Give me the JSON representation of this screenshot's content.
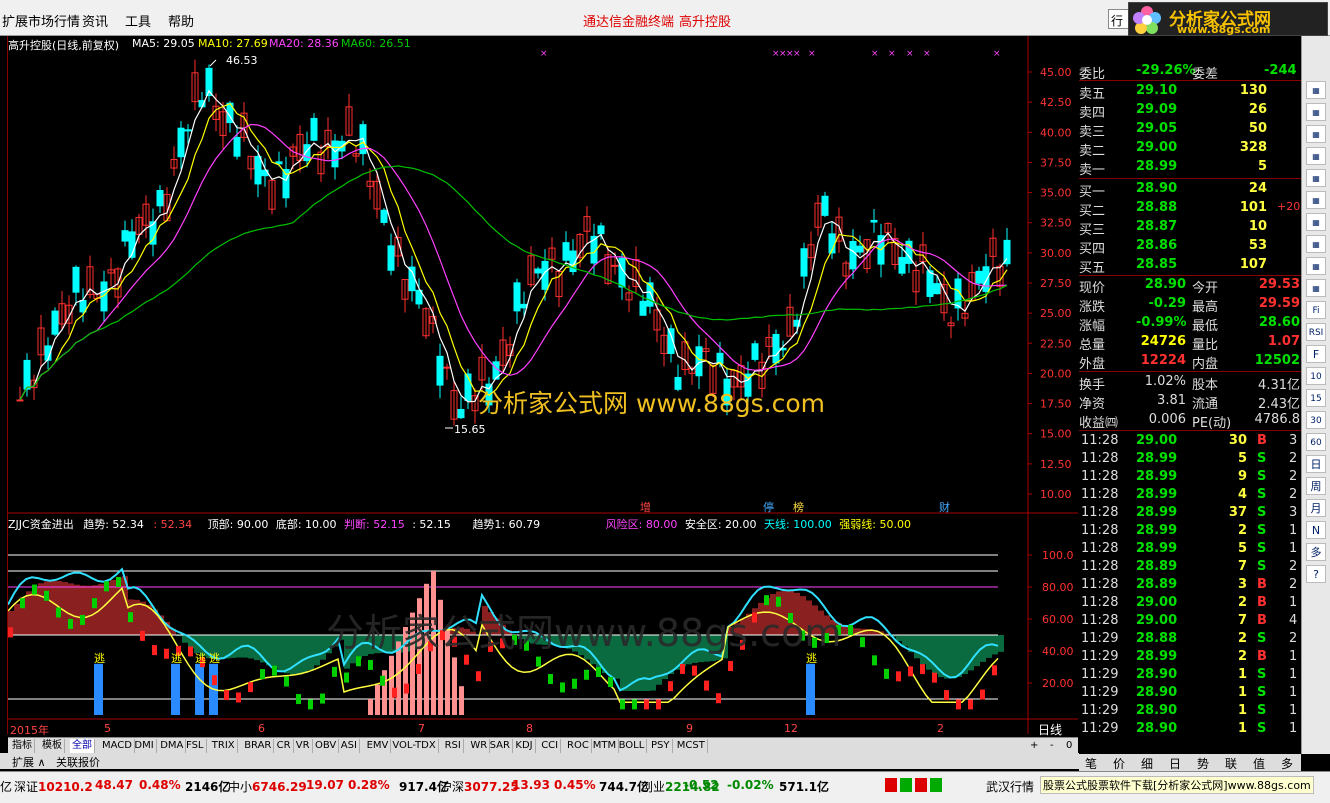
{
  "menubar": {
    "items": [
      "扩展市场行情",
      "资讯",
      "工具",
      "帮助"
    ],
    "red_items": [
      "通达信金融终端",
      "高升控股"
    ],
    "btn": "行"
  },
  "logo": {
    "title": "分析家公式网",
    "url": "www.88gs.com"
  },
  "main_chart": {
    "title": "高升控股(日线,前复权)",
    "ma": [
      {
        "label": "MA5: 29.05",
        "color": "#ffffff"
      },
      {
        "label": "MA10: 27.69",
        "color": "#ffff00"
      },
      {
        "label": "MA20: 28.36",
        "color": "#ff40ff"
      },
      {
        "label": "MA60: 26.51",
        "color": "#00c000"
      }
    ],
    "high_label": "46.53",
    "low_label": "15.65",
    "price_axis": [
      "45.00",
      "42.50",
      "40.00",
      "37.50",
      "35.00",
      "32.50",
      "30.00",
      "27.50",
      "25.00",
      "22.50",
      "20.00",
      "17.50",
      "15.00",
      "12.50",
      "10.00"
    ],
    "watermark": "分析家公式网 www.88gs.com",
    "event_labels": [
      {
        "text": "增",
        "color": "#ff4040"
      },
      {
        "text": "停",
        "color": "#40a0ff"
      },
      {
        "text": "榜",
        "color": "#ffd040"
      },
      {
        "text": "财",
        "color": "#40a0ff"
      }
    ]
  },
  "indicator": {
    "name": "ZJJC资金进出",
    "fields": [
      {
        "label": "趋势: 52.34",
        "color": "#ffffff"
      },
      {
        "label": ": 52.34",
        "color": "#ff4040"
      },
      {
        "label": "顶部: 90.00",
        "color": "#ffffff"
      },
      {
        "label": "底部: 10.00",
        "color": "#ffffff"
      },
      {
        "label": "判断: 52.15",
        "color": "#ff40ff"
      },
      {
        "label": ": 52.15",
        "color": "#ffffff"
      },
      {
        "label": "趋势1: 60.79",
        "color": "#ffffff"
      },
      {
        "label": "风险区: 80.00",
        "color": "#ff40ff"
      },
      {
        "label": "安全区: 20.00",
        "color": "#ffffff"
      },
      {
        "label": "天线: 100.00",
        "color": "#00ffff"
      },
      {
        "label": "强弱线: 50.00",
        "color": "#ffff00"
      }
    ],
    "axis": [
      "100.0",
      "80.00",
      "60.00",
      "40.00",
      "20.00"
    ],
    "flee_label": "逃",
    "watermark": "分析家公式网www.88gs.com"
  },
  "time_axis": {
    "labels": [
      "2015年",
      "5",
      "6",
      "7",
      "8",
      "9",
      "12",
      "2"
    ],
    "period": "日线"
  },
  "tabs": [
    "指标",
    "模板",
    "全部",
    "MACD",
    "DMI",
    "DMA",
    "FSL",
    "TRIX",
    "BRAR",
    "CR",
    "VR",
    "OBV",
    "ASI",
    "EMV",
    "VOL-TDX",
    "RSI",
    "WR",
    "SAR",
    "KDJ",
    "CCI",
    "ROC",
    "MTM",
    "BOLL",
    "PSY",
    "MCST"
  ],
  "ext_tabs": [
    "扩展 ∧",
    "关联报价"
  ],
  "quote": {
    "wb": {
      "label": "委比",
      "value": "-29.26%",
      "label2": "委差",
      "value2": "-244"
    },
    "sells": [
      {
        "label": "卖五",
        "price": "29.10",
        "vol": "130"
      },
      {
        "label": "卖四",
        "price": "29.09",
        "vol": "26"
      },
      {
        "label": "卖三",
        "price": "29.05",
        "vol": "50"
      },
      {
        "label": "卖二",
        "price": "29.00",
        "vol": "328"
      },
      {
        "label": "卖一",
        "price": "28.99",
        "vol": "5"
      }
    ],
    "buys": [
      {
        "label": "买一",
        "price": "28.90",
        "vol": "24",
        "chg": ""
      },
      {
        "label": "买二",
        "price": "28.88",
        "vol": "101",
        "chg": "+20"
      },
      {
        "label": "买三",
        "price": "28.87",
        "vol": "10",
        "chg": ""
      },
      {
        "label": "买四",
        "price": "28.86",
        "vol": "53",
        "chg": ""
      },
      {
        "label": "买五",
        "price": "28.85",
        "vol": "107",
        "chg": ""
      }
    ],
    "stats": [
      {
        "l1": "现价",
        "v1": "28.90",
        "c1": "#00e000",
        "l2": "今开",
        "v2": "29.53",
        "c2": "#ff3030"
      },
      {
        "l1": "涨跌",
        "v1": "-0.29",
        "c1": "#00e000",
        "l2": "最高",
        "v2": "29.59",
        "c2": "#ff3030"
      },
      {
        "l1": "涨幅",
        "v1": "-0.99%",
        "c1": "#00e000",
        "l2": "最低",
        "v2": "28.60",
        "c2": "#00e000"
      },
      {
        "l1": "总量",
        "v1": "24726",
        "c1": "#ffff00",
        "l2": "量比",
        "v2": "1.07",
        "c2": "#ff3030"
      },
      {
        "l1": "外盘",
        "v1": "12224",
        "c1": "#ff3030",
        "l2": "内盘",
        "v2": "12502",
        "c2": "#00e000"
      }
    ],
    "stats2": [
      {
        "l1": "换手",
        "v1": "1.02%",
        "l2": "股本",
        "v2": "4.31亿"
      },
      {
        "l1": "净资",
        "v1": "3.81",
        "l2": "流通",
        "v2": "2.43亿"
      },
      {
        "l1": "收益㈣",
        "v1": "0.006",
        "l2": "PE(动)",
        "v2": "4786.8"
      }
    ],
    "ticks": [
      {
        "t": "11:28",
        "p": "29.00",
        "v": "30",
        "d": "B",
        "n": "3"
      },
      {
        "t": "11:28",
        "p": "28.99",
        "v": "5",
        "d": "S",
        "n": "2"
      },
      {
        "t": "11:28",
        "p": "28.99",
        "v": "9",
        "d": "S",
        "n": "2"
      },
      {
        "t": "11:28",
        "p": "28.99",
        "v": "4",
        "d": "S",
        "n": "2"
      },
      {
        "t": "11:28",
        "p": "28.99",
        "v": "37",
        "d": "S",
        "n": "3"
      },
      {
        "t": "11:28",
        "p": "28.99",
        "v": "2",
        "d": "S",
        "n": "1"
      },
      {
        "t": "11:28",
        "p": "28.99",
        "v": "5",
        "d": "S",
        "n": "1"
      },
      {
        "t": "11:28",
        "p": "28.89",
        "v": "7",
        "d": "S",
        "n": "2"
      },
      {
        "t": "11:28",
        "p": "28.89",
        "v": "3",
        "d": "B",
        "n": "2"
      },
      {
        "t": "11:28",
        "p": "29.00",
        "v": "2",
        "d": "B",
        "n": "1"
      },
      {
        "t": "11:28",
        "p": "29.00",
        "v": "7",
        "d": "B",
        "n": "4"
      },
      {
        "t": "11:29",
        "p": "28.88",
        "v": "2",
        "d": "S",
        "n": "2"
      },
      {
        "t": "11:29",
        "p": "28.99",
        "v": "2",
        "d": "B",
        "n": "1"
      },
      {
        "t": "11:29",
        "p": "28.90",
        "v": "1",
        "d": "S",
        "n": "1"
      },
      {
        "t": "11:29",
        "p": "28.90",
        "v": "1",
        "d": "S",
        "n": "1"
      },
      {
        "t": "11:29",
        "p": "28.90",
        "v": "1",
        "d": "S",
        "n": "1"
      },
      {
        "t": "11:29",
        "p": "28.90",
        "v": "1",
        "d": "S",
        "n": "1"
      }
    ]
  },
  "right_tabs": [
    "笔",
    "价",
    "细",
    "日",
    "势",
    "联",
    "值",
    "多"
  ],
  "tools": [
    "Fi",
    "RSI",
    "F",
    "10",
    "15",
    "30",
    "60",
    "日",
    "周",
    "月",
    "N",
    "多",
    "?"
  ],
  "status": {
    "items": [
      {
        "name": "亿",
        "v": "",
        "c": ""
      },
      {
        "name": "深证",
        "v": "10210.2",
        "c": "#d00"
      },
      {
        "name": "",
        "v": "48.47",
        "c": "#d00"
      },
      {
        "name": "",
        "v": "0.48%",
        "c": "#d00"
      },
      {
        "name": "",
        "v": "2146亿",
        "c": "#000"
      },
      {
        "name": "中小",
        "v": "6746.29",
        "c": "#d00"
      },
      {
        "name": "",
        "v": "19.07",
        "c": "#d00"
      },
      {
        "name": "",
        "v": "0.28%",
        "c": "#d00"
      },
      {
        "name": "",
        "v": "917.4亿",
        "c": "#000"
      },
      {
        "name": "沪深",
        "v": "3077.25",
        "c": "#d00"
      },
      {
        "name": "",
        "v": "13.93",
        "c": "#d00"
      },
      {
        "name": "",
        "v": "0.45%",
        "c": "#d00"
      },
      {
        "name": "",
        "v": "744.7亿",
        "c": "#000"
      },
      {
        "name": "创业",
        "v": "2214.82",
        "c": "#080"
      },
      {
        "name": "",
        "v": "-0.52",
        "c": "#080"
      },
      {
        "name": "",
        "v": "-0.02%",
        "c": "#080"
      },
      {
        "name": "",
        "v": "571.1亿",
        "c": "#000"
      }
    ],
    "ticker": "武汉行情",
    "banner": "股票公式股票软件下载[分析家公式网]www.88gs.com"
  }
}
